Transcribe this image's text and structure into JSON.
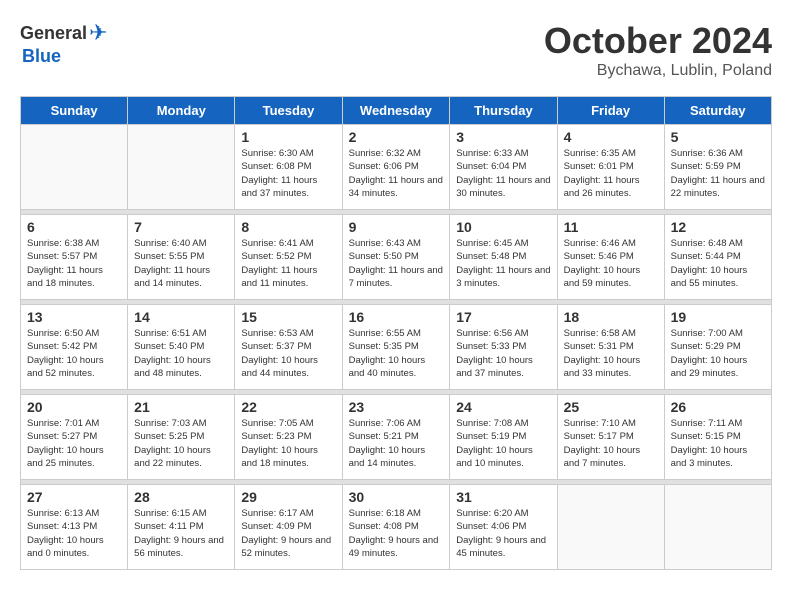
{
  "logo": {
    "general": "General",
    "blue": "Blue"
  },
  "title": {
    "month": "October 2024",
    "location": "Bychawa, Lublin, Poland"
  },
  "headers": [
    "Sunday",
    "Monday",
    "Tuesday",
    "Wednesday",
    "Thursday",
    "Friday",
    "Saturday"
  ],
  "weeks": [
    [
      {
        "day": "",
        "info": ""
      },
      {
        "day": "",
        "info": ""
      },
      {
        "day": "1",
        "info": "Sunrise: 6:30 AM\nSunset: 6:08 PM\nDaylight: 11 hours and 37 minutes."
      },
      {
        "day": "2",
        "info": "Sunrise: 6:32 AM\nSunset: 6:06 PM\nDaylight: 11 hours and 34 minutes."
      },
      {
        "day": "3",
        "info": "Sunrise: 6:33 AM\nSunset: 6:04 PM\nDaylight: 11 hours and 30 minutes."
      },
      {
        "day": "4",
        "info": "Sunrise: 6:35 AM\nSunset: 6:01 PM\nDaylight: 11 hours and 26 minutes."
      },
      {
        "day": "5",
        "info": "Sunrise: 6:36 AM\nSunset: 5:59 PM\nDaylight: 11 hours and 22 minutes."
      }
    ],
    [
      {
        "day": "6",
        "info": "Sunrise: 6:38 AM\nSunset: 5:57 PM\nDaylight: 11 hours and 18 minutes."
      },
      {
        "day": "7",
        "info": "Sunrise: 6:40 AM\nSunset: 5:55 PM\nDaylight: 11 hours and 14 minutes."
      },
      {
        "day": "8",
        "info": "Sunrise: 6:41 AM\nSunset: 5:52 PM\nDaylight: 11 hours and 11 minutes."
      },
      {
        "day": "9",
        "info": "Sunrise: 6:43 AM\nSunset: 5:50 PM\nDaylight: 11 hours and 7 minutes."
      },
      {
        "day": "10",
        "info": "Sunrise: 6:45 AM\nSunset: 5:48 PM\nDaylight: 11 hours and 3 minutes."
      },
      {
        "day": "11",
        "info": "Sunrise: 6:46 AM\nSunset: 5:46 PM\nDaylight: 10 hours and 59 minutes."
      },
      {
        "day": "12",
        "info": "Sunrise: 6:48 AM\nSunset: 5:44 PM\nDaylight: 10 hours and 55 minutes."
      }
    ],
    [
      {
        "day": "13",
        "info": "Sunrise: 6:50 AM\nSunset: 5:42 PM\nDaylight: 10 hours and 52 minutes."
      },
      {
        "day": "14",
        "info": "Sunrise: 6:51 AM\nSunset: 5:40 PM\nDaylight: 10 hours and 48 minutes."
      },
      {
        "day": "15",
        "info": "Sunrise: 6:53 AM\nSunset: 5:37 PM\nDaylight: 10 hours and 44 minutes."
      },
      {
        "day": "16",
        "info": "Sunrise: 6:55 AM\nSunset: 5:35 PM\nDaylight: 10 hours and 40 minutes."
      },
      {
        "day": "17",
        "info": "Sunrise: 6:56 AM\nSunset: 5:33 PM\nDaylight: 10 hours and 37 minutes."
      },
      {
        "day": "18",
        "info": "Sunrise: 6:58 AM\nSunset: 5:31 PM\nDaylight: 10 hours and 33 minutes."
      },
      {
        "day": "19",
        "info": "Sunrise: 7:00 AM\nSunset: 5:29 PM\nDaylight: 10 hours and 29 minutes."
      }
    ],
    [
      {
        "day": "20",
        "info": "Sunrise: 7:01 AM\nSunset: 5:27 PM\nDaylight: 10 hours and 25 minutes."
      },
      {
        "day": "21",
        "info": "Sunrise: 7:03 AM\nSunset: 5:25 PM\nDaylight: 10 hours and 22 minutes."
      },
      {
        "day": "22",
        "info": "Sunrise: 7:05 AM\nSunset: 5:23 PM\nDaylight: 10 hours and 18 minutes."
      },
      {
        "day": "23",
        "info": "Sunrise: 7:06 AM\nSunset: 5:21 PM\nDaylight: 10 hours and 14 minutes."
      },
      {
        "day": "24",
        "info": "Sunrise: 7:08 AM\nSunset: 5:19 PM\nDaylight: 10 hours and 10 minutes."
      },
      {
        "day": "25",
        "info": "Sunrise: 7:10 AM\nSunset: 5:17 PM\nDaylight: 10 hours and 7 minutes."
      },
      {
        "day": "26",
        "info": "Sunrise: 7:11 AM\nSunset: 5:15 PM\nDaylight: 10 hours and 3 minutes."
      }
    ],
    [
      {
        "day": "27",
        "info": "Sunrise: 6:13 AM\nSunset: 4:13 PM\nDaylight: 10 hours and 0 minutes."
      },
      {
        "day": "28",
        "info": "Sunrise: 6:15 AM\nSunset: 4:11 PM\nDaylight: 9 hours and 56 minutes."
      },
      {
        "day": "29",
        "info": "Sunrise: 6:17 AM\nSunset: 4:09 PM\nDaylight: 9 hours and 52 minutes."
      },
      {
        "day": "30",
        "info": "Sunrise: 6:18 AM\nSunset: 4:08 PM\nDaylight: 9 hours and 49 minutes."
      },
      {
        "day": "31",
        "info": "Sunrise: 6:20 AM\nSunset: 4:06 PM\nDaylight: 9 hours and 45 minutes."
      },
      {
        "day": "",
        "info": ""
      },
      {
        "day": "",
        "info": ""
      }
    ]
  ]
}
